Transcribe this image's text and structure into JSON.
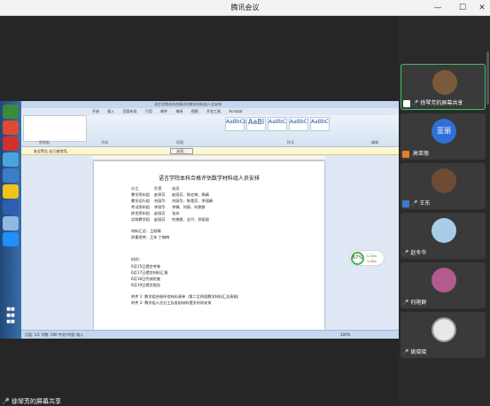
{
  "window": {
    "title": "腾讯会议"
  },
  "word": {
    "title_bar": "语言学院本科合格评估数学材料组人员安排",
    "tabs": [
      "开始",
      "插入",
      "页面布局",
      "引用",
      "邮件",
      "审阅",
      "视图",
      "开发工具",
      "Acrobat"
    ],
    "styles": [
      "AaBbCcDc",
      "AaBl",
      "AaBbC",
      "AaBbC",
      "AaBbC"
    ],
    "groups": [
      "剪贴板",
      "字体",
      "段落",
      "样式",
      "编辑"
    ],
    "security_bar": "安全警告  宏已被禁用。",
    "options_button": "选项...",
    "status": "页面: 1/1   字数: 190   中文(中国)   插入",
    "zoom": "100%"
  },
  "document": {
    "title": "语言学院本科合格评估数学材料组人员安排",
    "table_header": [
      "分工",
      "负责",
      "成员"
    ],
    "table_rows": [
      [
        "教学资料组",
        "赵琴芳",
        "赵丽芳、陈红梅、杨婧"
      ],
      [
        "教学运行组",
        "刘丽华",
        "刘丽华、陈雪芳、李丽娟"
      ],
      [
        "考试资料组",
        "李丽华",
        "李娟、刘丽、何艳群"
      ],
      [
        "综合资料组",
        "赵丽芳",
        "张苏"
      ],
      [
        "实践教学组",
        "赵丽芳",
        "何艳群、全丹、徐丽丽"
      ]
    ],
    "lines": [
      "材料汇总：王丽娟",
      "质量把关：王东  丁婉梅",
      "时间：",
      "6月15日提交考卷",
      "6月17日提交材料汇报",
      "6月18日完成检查",
      "6月19日提交报告",
      "附件 1: 数学组合格评估材料清单（第二至四组教学材料汇总表格）",
      "附件 2: 教学组人员分工及各组材料提交时间安排"
    ]
  },
  "gauge": {
    "value": "67",
    "unit": "%",
    "up": "0.2K/s",
    "down": "1.0K/s"
  },
  "share_caption": "徐琴芳的屏幕共享",
  "participants": [
    {
      "name": "徐琴芳的屏幕共享",
      "avatar": "",
      "color": "#7a5a3a",
      "active": true
    },
    {
      "name": "高亚丽",
      "avatar": "亚丽",
      "color": "#2f6fd6",
      "active": false
    },
    {
      "name": "王东",
      "avatar": "",
      "color": "#6e4b34",
      "active": false
    },
    {
      "name": "赵冬华",
      "avatar": "",
      "color": "#a9cde8",
      "active": false
    },
    {
      "name": "何艳群",
      "avatar": "",
      "color": "#b15b8f",
      "active": false
    },
    {
      "name": "姚晓晓",
      "avatar": "",
      "color": "#e8e8e8",
      "active": false
    }
  ]
}
